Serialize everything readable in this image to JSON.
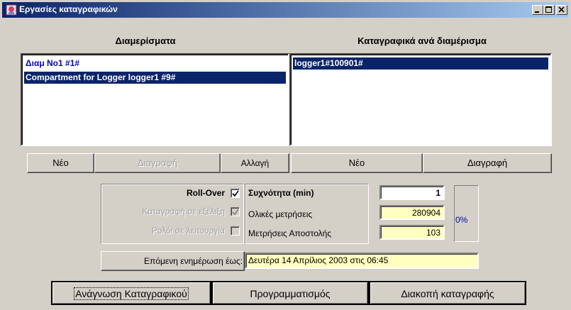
{
  "window": {
    "title": "Εργασίες καταγραφικών"
  },
  "compartments": {
    "heading": "Διαμερίσματα",
    "items": [
      "Διαμ Νο1 #1#",
      "Compartment for Logger logger1 #9#"
    ],
    "new_label": "Νέο",
    "delete_label": "Διαγραφή",
    "change_label": "Αλλαγή"
  },
  "loggers": {
    "heading": "Καταγραφικά ανά διαμέρισμα",
    "items": [
      "logger1#100901#"
    ],
    "new_label": "Νέο",
    "delete_label": "Διαγραφή"
  },
  "options": {
    "rollover_label": "Roll-Over",
    "rollover_checked": true,
    "recording_label": "Καταγραφή σε εξέλιξη",
    "recording_checked": true,
    "clock_label": "Ρολόι σε λειτουργία",
    "clock_checked": false
  },
  "stats": {
    "frequency_label": "Συχνότητα (min)",
    "frequency_value": "1",
    "total_label": "Ολικές μετρήσεις",
    "total_value": "280904",
    "sent_label": "Μετρήσεις Αποστολής",
    "sent_value": "103",
    "percent": "0%"
  },
  "update": {
    "label": "Επόμενη ενημέρωση έως:",
    "value": "Δευτέρα 14 Απρίλιος 2003 στις 06:45"
  },
  "actions": {
    "read_label": "Ανάγνωση Καταγραφικού",
    "program_label": "Προγραμματισμός",
    "stop_label": "Διακοπή καταγραφής"
  },
  "colors": {
    "titlebar_start": "#0a246a",
    "titlebar_end": "#a6caf0",
    "selection": "#0a246a",
    "field_yellow": "#ffffc0"
  }
}
